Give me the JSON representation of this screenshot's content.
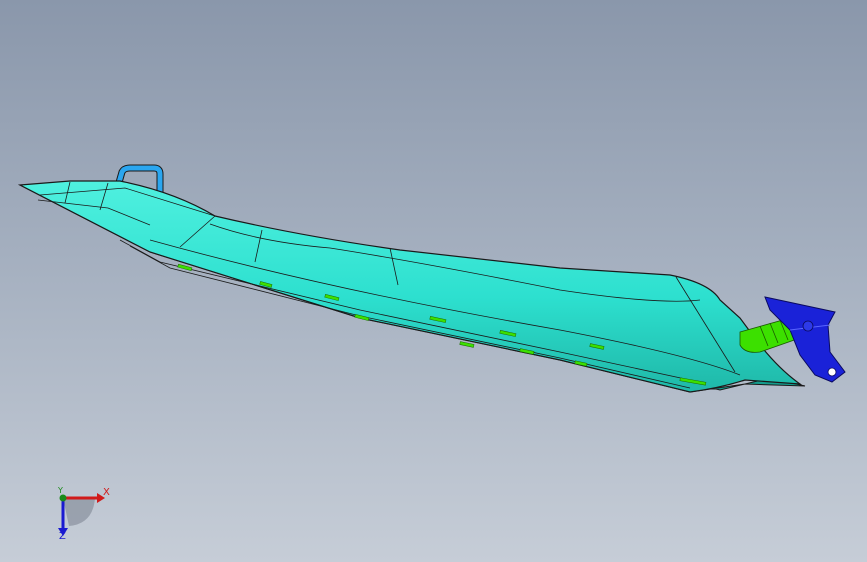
{
  "viewport": {
    "background_top": "#8a97ab",
    "background_bottom": "#c6cdd7"
  },
  "model": {
    "hull_color": "#2de0cf",
    "hull_shadow_color": "#1fb8a8",
    "edge_color": "#1a1a1a",
    "feature_color": "#3ce000",
    "handle_color": "#2aa6f0",
    "bracket_color": "#1a22d8"
  },
  "triad": {
    "x_label": "X",
    "y_label": "Y",
    "z_label": "Z",
    "x_color": "#d11a1a",
    "y_color": "#1a8a1a",
    "z_color": "#1a1ad1"
  }
}
